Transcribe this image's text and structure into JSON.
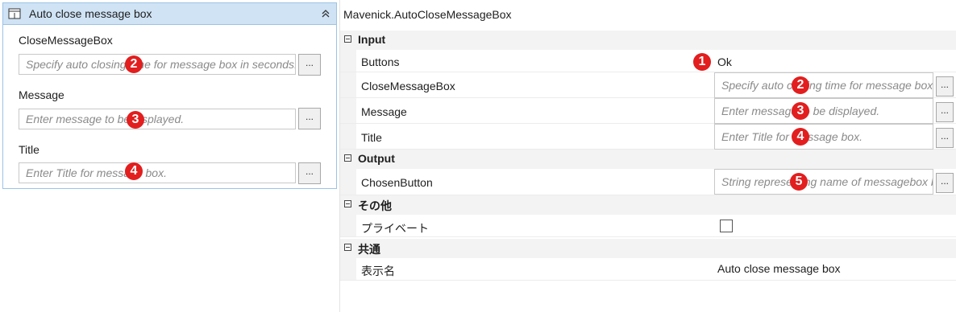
{
  "activity": {
    "title": "Auto close message box",
    "fields": [
      {
        "label": "CloseMessageBox",
        "placeholder": "Specify auto closing time for message box in seconds.",
        "badge": "2",
        "button": "..."
      },
      {
        "label": "Message",
        "placeholder": "Enter message to be displayed.",
        "badge": "3",
        "button": "..."
      },
      {
        "label": "Title",
        "placeholder": "Enter Title for message box.",
        "badge": "4",
        "button": "..."
      }
    ]
  },
  "properties": {
    "title": "Mavenick.AutoCloseMessageBox",
    "sections": {
      "input": "Input",
      "output": "Output",
      "misc": "その他",
      "common": "共通"
    },
    "input": {
      "buttons": {
        "label": "Buttons",
        "value": "Ok",
        "badge": "1"
      },
      "close_message_box": {
        "label": "CloseMessageBox",
        "placeholder": "Specify auto closing time for message box in seconds.",
        "badge": "2",
        "button": "..."
      },
      "message": {
        "label": "Message",
        "placeholder": "Enter message to be displayed.",
        "badge": "3",
        "button": "..."
      },
      "title": {
        "label": "Title",
        "placeholder": "Enter Title for message box.",
        "badge": "4",
        "button": "..."
      }
    },
    "output": {
      "chosen_button": {
        "label": "ChosenButton",
        "placeholder": "String representing name of messagebox button",
        "badge": "5",
        "button": "..."
      }
    },
    "misc": {
      "private": {
        "label": "プライベート",
        "checked": false
      }
    },
    "common": {
      "display_name": {
        "label": "表示名",
        "value": "Auto close message box"
      }
    }
  },
  "colors": {
    "badge": "#e21e1e",
    "card_header": "#cfe3f5",
    "card_border": "#9cc3e5"
  }
}
